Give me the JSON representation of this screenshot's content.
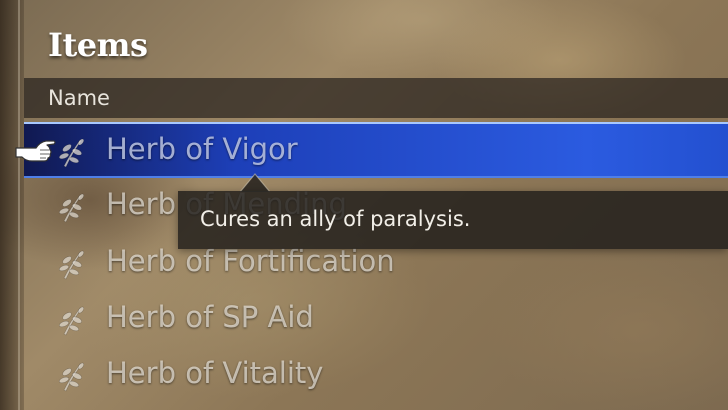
{
  "menu": {
    "title": "Items",
    "column_header": "Name"
  },
  "items": [
    {
      "label": "Herb of Vigor",
      "icon": "herb-icon",
      "selected": true
    },
    {
      "label": "Herb of Mending",
      "icon": "herb-icon",
      "selected": false
    },
    {
      "label": "Herb of Fortification",
      "icon": "herb-icon",
      "selected": false
    },
    {
      "label": "Herb of SP Aid",
      "icon": "herb-icon",
      "selected": false
    },
    {
      "label": "Herb of Vitality",
      "icon": "herb-icon",
      "selected": false
    }
  ],
  "tooltip": {
    "text": "Cures an ally of paralysis."
  },
  "colors": {
    "selection": "#2b5be0",
    "tooltip_bg": "#1e1c1a"
  }
}
